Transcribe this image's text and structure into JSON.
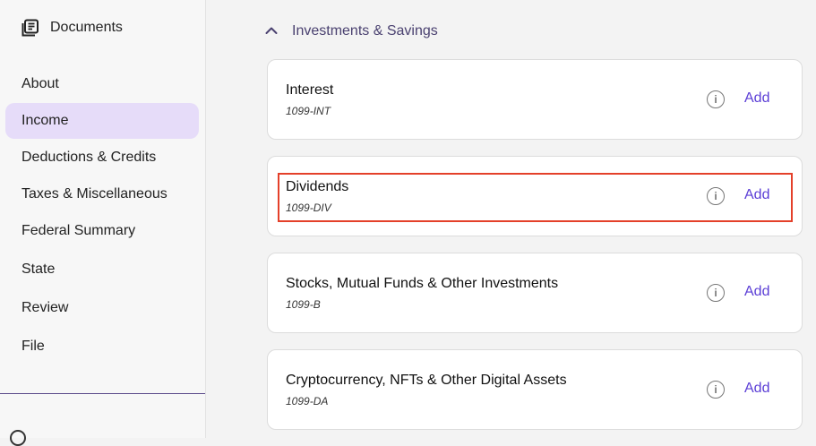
{
  "sidebar": {
    "documents_label": "Documents",
    "items": [
      {
        "label": "About"
      },
      {
        "label": "Income"
      },
      {
        "label": "Deductions & Credits"
      },
      {
        "label": "Taxes & Miscellaneous"
      },
      {
        "label": "Federal Summary"
      },
      {
        "label": "State"
      },
      {
        "label": "Review"
      },
      {
        "label": "File"
      }
    ],
    "active_item": "Income"
  },
  "main": {
    "section_title": "Investments & Savings",
    "cards": [
      {
        "title": "Interest",
        "subtitle": "1099-INT",
        "add_label": "Add",
        "info_glyph": "i"
      },
      {
        "title": "Dividends",
        "subtitle": "1099-DIV",
        "add_label": "Add",
        "info_glyph": "i"
      },
      {
        "title": "Stocks, Mutual Funds & Other Investments",
        "subtitle": "1099-B",
        "add_label": "Add",
        "info_glyph": "i"
      },
      {
        "title": "Cryptocurrency, NFTs & Other Digital Assets",
        "subtitle": "1099-DA",
        "add_label": "Add",
        "info_glyph": "i"
      }
    ]
  },
  "colors": {
    "accent": "#5b3ed6",
    "active_nav_bg": "#e6dcf9",
    "highlight": "#e4402a",
    "section_title": "#4a4170"
  },
  "icons": {
    "documents": "documents-icon",
    "chevron": "chevron-up-icon",
    "info": "info-icon"
  }
}
